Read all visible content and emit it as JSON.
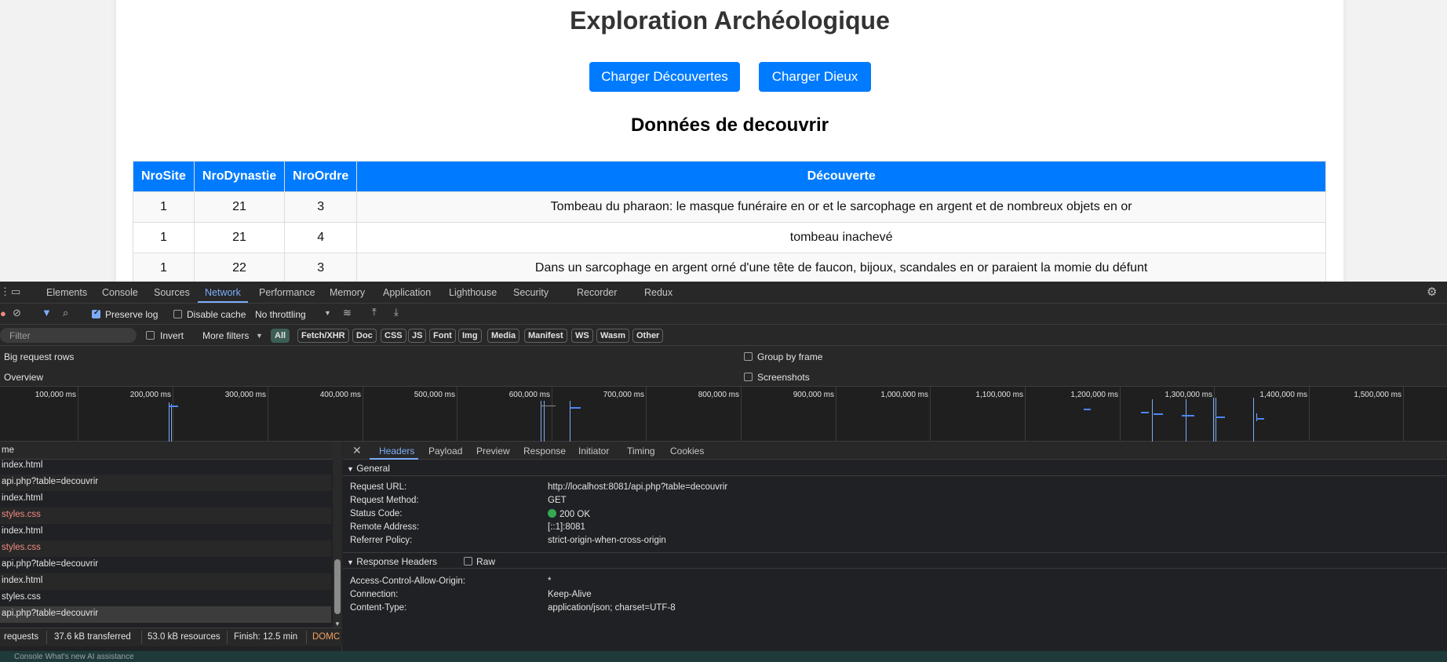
{
  "page": {
    "title": "Exploration Archéologique",
    "buttons": {
      "decouvertes": "Charger Découvertes",
      "dieux": "Charger Dieux"
    },
    "section_heading": "Données de decouvrir",
    "table": {
      "headers": [
        "NroSite",
        "NroDynastie",
        "NroOrdre",
        "Découverte"
      ],
      "rows": [
        [
          "1",
          "21",
          "3",
          "Tombeau du pharaon: le masque funéraire en or et le sarcophage en argent et de nombreux objets en or"
        ],
        [
          "1",
          "21",
          "4",
          "tombeau inachevé"
        ],
        [
          "1",
          "22",
          "3",
          "Dans un sarcophage en argent orné d'une tête de faucon, bijoux, scandales en or paraient la momie du défunt"
        ]
      ]
    }
  },
  "devtools": {
    "tabs": [
      "Elements",
      "Console",
      "Sources",
      "Network",
      "Performance",
      "Memory",
      "Application",
      "Lighthouse",
      "Security",
      "Recorder",
      "Redux"
    ],
    "active_tab": "Network",
    "toolbar": {
      "preserve_log": "Preserve log",
      "disable_cache": "Disable cache",
      "throttling": "No throttling"
    },
    "filter": {
      "placeholder": "Filter",
      "invert": "Invert",
      "more_filters": "More filters",
      "types": [
        "All",
        "Fetch/XHR",
        "Doc",
        "CSS",
        "JS",
        "Font",
        "Img",
        "Media",
        "Manifest",
        "WS",
        "Wasm",
        "Other"
      ]
    },
    "options": {
      "big_rows": "Big request rows",
      "overview": "Overview",
      "group_by_frame": "Group by frame",
      "screenshots": "Screenshots"
    },
    "timeline_ticks": [
      "100,000 ms",
      "200,000 ms",
      "300,000 ms",
      "400,000 ms",
      "500,000 ms",
      "600,000 ms",
      "700,000 ms",
      "800,000 ms",
      "900,000 ms",
      "1,000,000 ms",
      "1,100,000 ms",
      "1,200,000 ms",
      "1,300,000 ms",
      "1,400,000 ms",
      "1,500,000 ms"
    ],
    "list": {
      "header": "me",
      "rows": [
        "index.html",
        "api.php?table=decouvrir",
        "index.html",
        "styles.css",
        "index.html",
        "styles.css",
        "api.php?table=decouvrir",
        "index.html",
        "styles.css",
        "api.php?table=decouvrir"
      ]
    },
    "statusbar": {
      "requests": "requests",
      "transferred": "37.6 kB transferred",
      "resources": "53.0 kB resources",
      "finish": "Finish: 12.5 min",
      "domc": "DOMC"
    },
    "detail": {
      "tabs": [
        "Headers",
        "Payload",
        "Preview",
        "Response",
        "Initiator",
        "Timing",
        "Cookies"
      ],
      "general_title": "General",
      "general": [
        {
          "key": "Request URL:",
          "value": "http://localhost:8081/api.php?table=decouvrir"
        },
        {
          "key": "Request Method:",
          "value": "GET"
        },
        {
          "key": "Status Code:",
          "value": "200 OK"
        },
        {
          "key": "Remote Address:",
          "value": "[::1]:8081"
        },
        {
          "key": "Referrer Policy:",
          "value": "strict-origin-when-cross-origin"
        }
      ],
      "response_title": "Response Headers",
      "raw": "Raw",
      "response": [
        {
          "key": "Access-Control-Allow-Origin:",
          "value": "*"
        },
        {
          "key": "Connection:",
          "value": "Keep-Alive"
        },
        {
          "key": "Content-Type:",
          "value": "application/json; charset=UTF-8"
        }
      ]
    },
    "bottom_drawer": "Console   What's new   AI assistance"
  }
}
